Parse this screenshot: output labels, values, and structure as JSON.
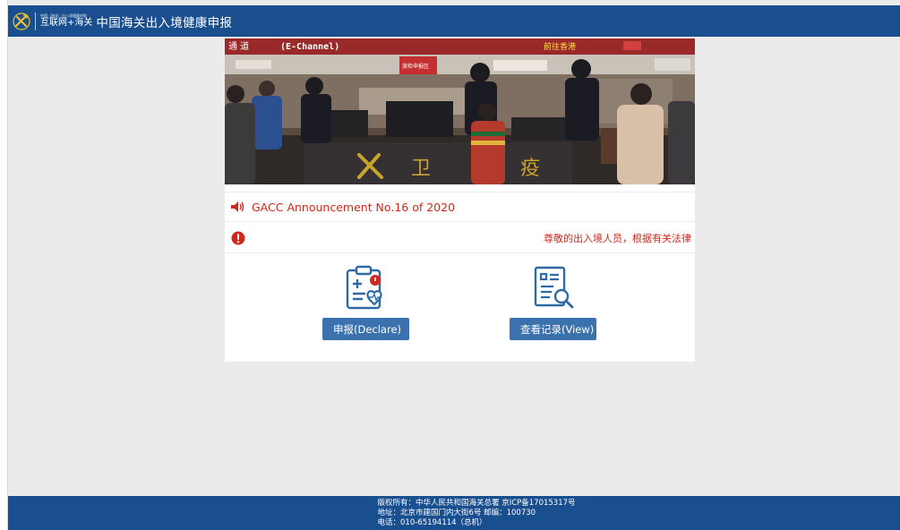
{
  "header": {
    "logo_small_text": "中国（海关）出入境健康申报",
    "logo_main_text": "互联网+海关",
    "title": "中国海关出入境健康申报"
  },
  "banner": {
    "sign_left": "通 道",
    "sign_channel": "(E-Channel)",
    "sign_right": "前往香港",
    "sign_center": "旅检申报区"
  },
  "announcement": {
    "text": "GACC Announcement No.16 of 2020"
  },
  "alert": {
    "text": "尊敬的出入境人员，根据有关法律"
  },
  "actions": {
    "declare_label": "申报(Declare)",
    "view_label": "查看记录(View)"
  },
  "footer": {
    "line1": "版权所有：中华人民共和国海关总署 京ICP备17015317号",
    "line2": "地址：北京市建国门内大街6号 邮编：100730",
    "line3": "电话：010-65194114（总机）"
  },
  "colors": {
    "brand_blue": "#1a4f8f",
    "button_blue": "#3b72ad",
    "alert_red": "#d0281e",
    "page_bg": "#ebebeb"
  },
  "icons": {
    "logo": "customs-emblem-icon",
    "announcement": "speaker-icon",
    "alert": "exclamation-circle-icon",
    "declare": "health-declaration-clipboard-icon",
    "view": "document-search-icon"
  }
}
